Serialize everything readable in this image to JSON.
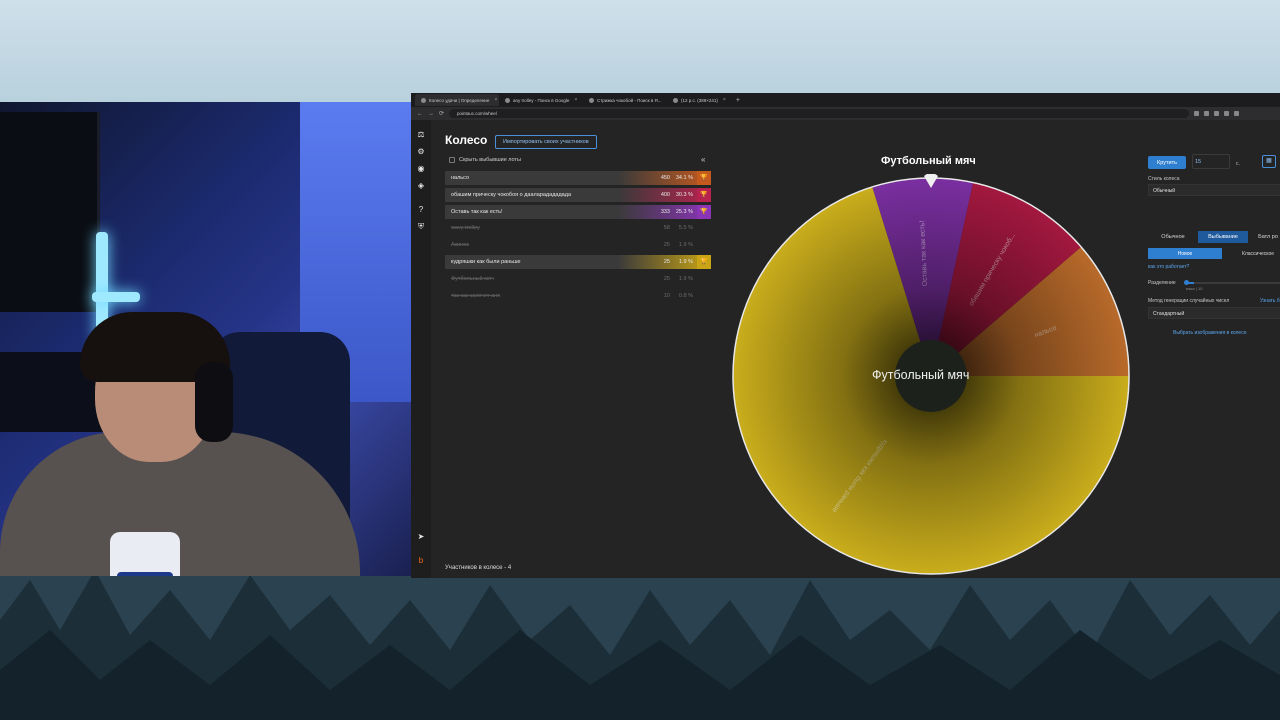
{
  "browser": {
    "tabs": [
      {
        "label": "Колесо удачи | Определение",
        "active": true
      },
      {
        "label": "any trolley - Поиск в Google",
        "active": false
      },
      {
        "label": "Стрижка чокобой - Поиск в Я...",
        "active": false
      },
      {
        "label": "(12 р.с. (389×241)",
        "active": false
      }
    ],
    "new_tab": "+",
    "url": "pointauc.com/wheel"
  },
  "rail": {
    "icons": [
      "gavel-icon",
      "settings-icon",
      "wheel-icon",
      "layers-icon",
      "help-icon",
      "shield-icon",
      "telegram-icon",
      "boosty-icon"
    ]
  },
  "page": {
    "title": "Колесо",
    "import_button": "Импортировать своих участников",
    "hide_toggle": "Скрыть выбывшие лоты",
    "collapse": "«",
    "participants_count": "Участников в колесе - 4"
  },
  "lots": [
    {
      "name": "нальсо",
      "amount": "450",
      "pct": "34.1 %",
      "active": true,
      "color": "#c45a1e"
    },
    {
      "name": "обашим прическу чокобоя о дааларадададада",
      "amount": "400",
      "pct": "30.3 %",
      "active": true,
      "color": "#b8224f"
    },
    {
      "name": "Оставь так как есть!",
      "amount": "333",
      "pct": "25.3 %",
      "active": true,
      "color": "#8b34b8"
    },
    {
      "name": "wavy trolley",
      "amount": "58",
      "pct": "5.5 %",
      "active": false
    },
    {
      "name": "Акинос",
      "amount": "25",
      "pct": "1.9 %",
      "active": false
    },
    {
      "name": "кудряшки как были раньше",
      "amount": "25",
      "pct": "1.9 %",
      "active": true,
      "color": "#c9a414"
    },
    {
      "name": "Футбольный мяч",
      "amount": "25",
      "pct": "1.9 %",
      "active": false
    },
    {
      "name": "так как захочет аня",
      "amount": "10",
      "pct": "0.8 %",
      "active": false
    }
  ],
  "wheel": {
    "winner_title": "Футбольный мяч",
    "center_text": "Футбольный мяч",
    "slices": [
      {
        "label": "нальсо",
        "share": 0.113,
        "color": "#b86a2a"
      },
      {
        "label": "обашим прическу чокоб...",
        "share": 0.103,
        "color": "#a3183f"
      },
      {
        "label": "Оставь так как есть!",
        "share": 0.082,
        "color": "#7a2fa0"
      },
      {
        "label": "кудряшки как были раньше",
        "share": 0.702,
        "color": "#c9ad1c"
      }
    ]
  },
  "panel": {
    "spin_button": "Крутить",
    "duration_value": "15",
    "duration_unit": "с.",
    "wheel_style_label": "Стиль колеса",
    "wheel_style_value": "Обычный",
    "modes": [
      "Обычное",
      "Выбывание",
      "Батл ро"
    ],
    "selected_mode": "Выбывание",
    "submodes": [
      "Новое",
      "Классическое"
    ],
    "selected_submode": "Новое",
    "how_it_works": "как это работает?",
    "split_label": "Разделение",
    "split_hint": "макс | 10",
    "split_fraction": 0.08,
    "rng_label": "Метод генерации случайных чисел",
    "rng_link": "Узнать б",
    "rng_value": "Стандартный",
    "images_link": "Выбрать изображения в колесе"
  }
}
